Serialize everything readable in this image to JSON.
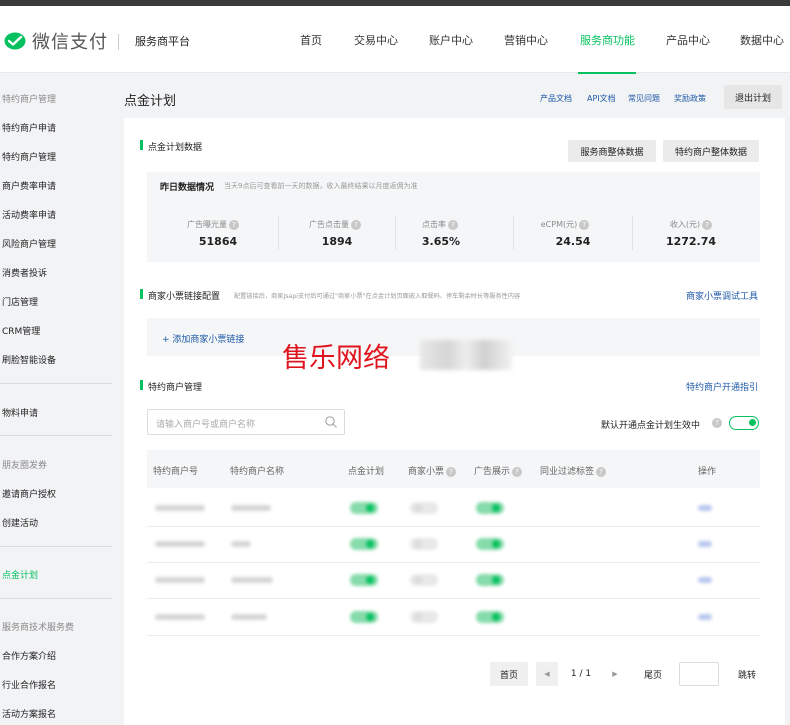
{
  "header": {
    "logo_text": "微信支付",
    "platform": "服务商平台",
    "nav": [
      "首页",
      "交易中心",
      "账户中心",
      "营销中心",
      "服务商功能",
      "产品中心",
      "数据中心"
    ],
    "active_nav": "服务商功能"
  },
  "sidebar": {
    "items": [
      {
        "label": "特约商户管理",
        "type": "group"
      },
      {
        "label": "特约商户申请",
        "type": "item"
      },
      {
        "label": "特约商户管理",
        "type": "item"
      },
      {
        "label": "商户费率申请",
        "type": "item"
      },
      {
        "label": "活动费率申请",
        "type": "item"
      },
      {
        "label": "风险商户管理",
        "type": "item"
      },
      {
        "label": "消费者投诉",
        "type": "item"
      },
      {
        "label": "门店管理",
        "type": "item"
      },
      {
        "label": "CRM管理",
        "type": "item"
      },
      {
        "label": "刷脸智能设备",
        "type": "item"
      },
      {
        "label": "物料申请",
        "type": "item"
      },
      {
        "label": "朋友圈发券",
        "type": "group"
      },
      {
        "label": "邀请商户授权",
        "type": "item"
      },
      {
        "label": "创建活动",
        "type": "item"
      },
      {
        "label": "点金计划",
        "type": "active"
      },
      {
        "label": "服务商技术服务费",
        "type": "group"
      },
      {
        "label": "合作方案介绍",
        "type": "item"
      },
      {
        "label": "行业合作报名",
        "type": "item"
      },
      {
        "label": "活动方案报名",
        "type": "item"
      }
    ]
  },
  "page": {
    "title": "点金计划",
    "links": [
      "产品文档",
      "API文档",
      "常见问题",
      "奖励政策"
    ],
    "exit_button": "退出计划"
  },
  "data_section": {
    "title": "点金计划数据",
    "btn_provider": "服务商整体数据",
    "btn_merchant": "特约商户整体数据",
    "yesterday_label": "昨日数据情况",
    "yesterday_note": "当天9点后可查看前一天的数据，收入最终结果以月度返佣为准",
    "stats": [
      {
        "label": "广告曝光量",
        "value": "51864"
      },
      {
        "label": "广告点击量",
        "value": "1894"
      },
      {
        "label": "点击率",
        "value": "3.65%"
      },
      {
        "label": "eCPM(元)",
        "value": "24.54"
      },
      {
        "label": "收入(元)",
        "value": "1272.74"
      }
    ]
  },
  "link_section": {
    "title": "商家小票链接配置",
    "desc": "配置链接后，商家Jsapi支付后可通过\"商家小票\"在点金计划页面嵌入取餐码、停车剩余时长等服务性内容",
    "tool_link": "商家小票调试工具",
    "add_link": "+ 添加商家小票链接"
  },
  "merchant_section": {
    "title": "特约商户管理",
    "guide_link": "特约商户开通指引",
    "search_placeholder": "请输入商户号或商户名称",
    "default_toggle_label": "默认开通点金计划生效中",
    "default_toggle_on": true,
    "columns": [
      "特约商户号",
      "特约商户名称",
      "点金计划",
      "商家小票",
      "广告展示",
      "同业过滤标签",
      "操作"
    ],
    "rows": [
      {
        "plan": true,
        "receipt": false,
        "ads": true
      },
      {
        "plan": true,
        "receipt": false,
        "ads": true
      },
      {
        "plan": true,
        "receipt": false,
        "ads": true
      },
      {
        "plan": true,
        "receipt": false,
        "ads": true
      }
    ]
  },
  "pagination": {
    "first": "首页",
    "prev": "◀",
    "current": "1 / 1",
    "next": "▶",
    "last": "尾页",
    "jump": "跳转"
  },
  "watermark": "售乐网络",
  "colors": {
    "accent": "#07c160",
    "link": "#1f5aa8"
  }
}
